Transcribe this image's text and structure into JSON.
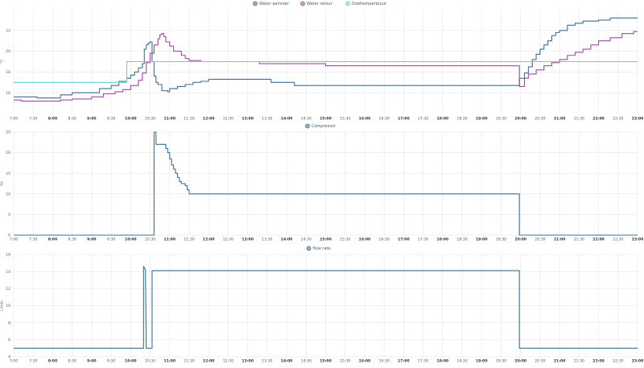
{
  "time_ticks": [
    "7:00",
    "7:30",
    "8:00",
    "8:30",
    "9:00",
    "9:30",
    "10:00",
    "10:30",
    "11:00",
    "11:30",
    "12:00",
    "12:30",
    "13:00",
    "13:30",
    "14:00",
    "14:30",
    "15:00",
    "15:30",
    "16:00",
    "16:30",
    "17:00",
    "17:30",
    "18:00",
    "18:30",
    "19:00",
    "19:30",
    "20:00",
    "20:30",
    "21:00",
    "21:30",
    "22:00",
    "22:30",
    "23:00"
  ],
  "bold_ticks": [
    "8:00",
    "9:00",
    "10:00",
    "11:00",
    "12:00",
    "13:00",
    "14:00",
    "15:00",
    "16:00",
    "17:00",
    "18:00",
    "19:00",
    "20:00",
    "21:00",
    "22:00",
    "23:00"
  ],
  "chart_data": [
    {
      "type": "line",
      "step": true,
      "ylabel": "°C",
      "ylim": [
        14,
        24
      ],
      "yticks": [
        16,
        18,
        20,
        22
      ],
      "xlim": [
        7.0,
        23.0
      ],
      "grid": true,
      "legend_position": "top-center",
      "series": [
        {
          "name": "Water aanvoer",
          "color": "#3d6f99",
          "points": [
            [
              7.0,
              15.6
            ],
            [
              7.4,
              15.6
            ],
            [
              7.6,
              15.5
            ],
            [
              8.1,
              15.5
            ],
            [
              8.2,
              15.8
            ],
            [
              8.5,
              16.0
            ],
            [
              9.0,
              16.0
            ],
            [
              9.2,
              16.4
            ],
            [
              9.5,
              16.7
            ],
            [
              9.7,
              17.1
            ],
            [
              9.9,
              17.4
            ],
            [
              10.0,
              17.7
            ],
            [
              10.1,
              18.0
            ],
            [
              10.2,
              18.4
            ],
            [
              10.3,
              18.8
            ],
            [
              10.35,
              20.2
            ],
            [
              10.4,
              20.6
            ],
            [
              10.45,
              20.8
            ],
            [
              10.5,
              20.9
            ],
            [
              10.55,
              19.0
            ],
            [
              10.6,
              17.6
            ],
            [
              10.65,
              17.0
            ],
            [
              10.7,
              16.8
            ],
            [
              10.8,
              16.2
            ],
            [
              10.95,
              16.1
            ],
            [
              11.0,
              16.4
            ],
            [
              11.2,
              16.6
            ],
            [
              11.4,
              16.8
            ],
            [
              11.6,
              17.0
            ],
            [
              11.8,
              17.1
            ],
            [
              12.0,
              17.3
            ],
            [
              13.6,
              17.3
            ],
            [
              13.6,
              17.0
            ],
            [
              14.2,
              17.0
            ],
            [
              14.2,
              16.7
            ],
            [
              19.97,
              16.7
            ],
            [
              19.97,
              17.4
            ],
            [
              20.1,
              17.9
            ],
            [
              20.2,
              18.5
            ],
            [
              20.3,
              19.2
            ],
            [
              20.4,
              19.7
            ],
            [
              20.5,
              20.2
            ],
            [
              20.6,
              20.6
            ],
            [
              20.7,
              21.0
            ],
            [
              20.8,
              21.5
            ],
            [
              20.9,
              21.8
            ],
            [
              21.0,
              22.0
            ],
            [
              21.2,
              22.5
            ],
            [
              21.4,
              22.7
            ],
            [
              21.6,
              22.9
            ],
            [
              22.0,
              23.0
            ],
            [
              22.3,
              23.2
            ],
            [
              23.0,
              23.2
            ]
          ]
        },
        {
          "name": "Water retour",
          "color": "#a04aa3",
          "points": [
            [
              7.0,
              15.3
            ],
            [
              7.2,
              15.2
            ],
            [
              8.0,
              15.2
            ],
            [
              8.2,
              15.3
            ],
            [
              8.5,
              15.4
            ],
            [
              9.0,
              15.6
            ],
            [
              9.3,
              15.9
            ],
            [
              9.6,
              16.1
            ],
            [
              9.8,
              16.3
            ],
            [
              10.0,
              16.7
            ],
            [
              10.2,
              17.2
            ],
            [
              10.3,
              17.9
            ],
            [
              10.4,
              18.9
            ],
            [
              10.5,
              19.8
            ],
            [
              10.6,
              20.6
            ],
            [
              10.7,
              21.2
            ],
            [
              10.75,
              21.6
            ],
            [
              10.8,
              21.7
            ],
            [
              10.85,
              21.4
            ],
            [
              10.9,
              20.9
            ],
            [
              11.0,
              20.5
            ],
            [
              11.1,
              20.0
            ],
            [
              11.3,
              19.6
            ],
            [
              11.4,
              19.3
            ],
            [
              11.5,
              19.1
            ],
            [
              11.8,
              19.0
            ],
            [
              13.3,
              19.0
            ],
            [
              13.3,
              18.8
            ],
            [
              15.0,
              18.8
            ],
            [
              15.0,
              18.6
            ],
            [
              19.97,
              18.6
            ],
            [
              19.97,
              16.6
            ],
            [
              20.1,
              17.4
            ],
            [
              20.2,
              17.8
            ],
            [
              20.4,
              18.2
            ],
            [
              20.6,
              18.6
            ],
            [
              20.8,
              18.9
            ],
            [
              21.0,
              19.2
            ],
            [
              21.2,
              19.6
            ],
            [
              21.4,
              19.9
            ],
            [
              21.6,
              20.2
            ],
            [
              21.8,
              20.6
            ],
            [
              22.0,
              21.0
            ],
            [
              22.3,
              21.3
            ],
            [
              22.6,
              21.7
            ],
            [
              22.9,
              21.9
            ],
            [
              23.0,
              21.9
            ]
          ]
        },
        {
          "name": "Doeltemperatuur",
          "color": "#5fd3d3",
          "points": [
            [
              7.0,
              17.0
            ],
            [
              9.9,
              17.0
            ],
            [
              9.9,
              19.0
            ],
            [
              23.0,
              19.0
            ]
          ]
        }
      ]
    },
    {
      "type": "line",
      "step": true,
      "ylabel": "Hz",
      "ylim": [
        0,
        25
      ],
      "yticks": [
        0,
        5,
        10,
        15,
        20,
        25
      ],
      "xlim": [
        7.0,
        23.0
      ],
      "grid": true,
      "legend_position": "top-center",
      "series": [
        {
          "name": "Compressor",
          "color": "#3d6f99",
          "points": [
            [
              7.0,
              0
            ],
            [
              10.6,
              0
            ],
            [
              10.6,
              25
            ],
            [
              10.65,
              22
            ],
            [
              10.85,
              22
            ],
            [
              10.9,
              21
            ],
            [
              10.95,
              20
            ],
            [
              11.0,
              18.5
            ],
            [
              11.05,
              17
            ],
            [
              11.1,
              16
            ],
            [
              11.15,
              15
            ],
            [
              11.2,
              14
            ],
            [
              11.25,
              13
            ],
            [
              11.3,
              12.5
            ],
            [
              11.4,
              12
            ],
            [
              11.45,
              11
            ],
            [
              11.5,
              10
            ],
            [
              19.97,
              10
            ],
            [
              19.97,
              0
            ],
            [
              23.0,
              0
            ]
          ]
        }
      ]
    },
    {
      "type": "line",
      "ylabel": "L/min",
      "ylim": [
        4,
        16
      ],
      "yticks": [
        4,
        6,
        8,
        10,
        12,
        14,
        16
      ],
      "xlim": [
        7.0,
        23.0
      ],
      "grid": true,
      "legend_position": "top-center",
      "series": [
        {
          "name": "flow rate",
          "color": "#3d6f99",
          "points": [
            [
              7.0,
              5
            ],
            [
              10.33,
              5
            ],
            [
              10.33,
              14.6
            ],
            [
              10.38,
              14.2
            ],
            [
              10.4,
              5
            ],
            [
              10.55,
              5
            ],
            [
              10.55,
              14.1
            ],
            [
              19.97,
              14.1
            ],
            [
              19.97,
              5
            ],
            [
              23.0,
              5
            ]
          ]
        }
      ]
    }
  ]
}
